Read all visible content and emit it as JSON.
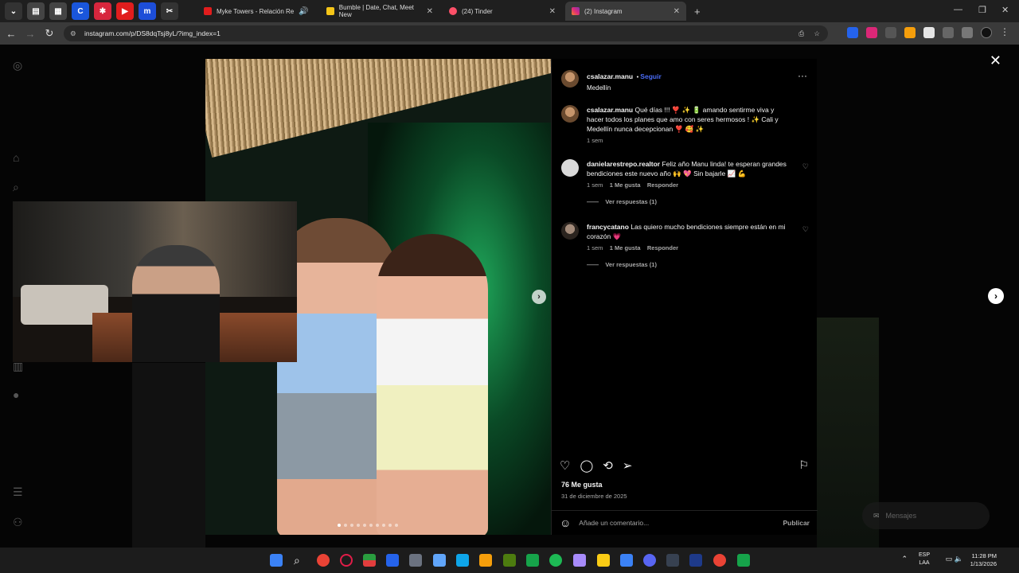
{
  "browser": {
    "tabs": [
      {
        "title": "Myke Towers - Relación Re",
        "audio": true
      },
      {
        "title": "Bumble | Date, Chat, Meet New"
      },
      {
        "title": "(24) Tinder"
      },
      {
        "title": "(2) Instagram",
        "active": true
      }
    ],
    "new_tab": "+",
    "url": "instagram.com/p/DS8dqTsj8yL/?img_index=1"
  },
  "post": {
    "author": "csalazar.manu",
    "follow_label": "Seguir",
    "location": "Medellín",
    "caption": "Qué días !!! ❣️ ✨ 🔋 amando sentirme viva y hacer todos los planes que amo con seres hermosos ! ✨ Cali y Medellín nunca decepcionan ❣️ 🥰 ✨",
    "caption_time": "1 sem",
    "comments": [
      {
        "user": "danielarestrepo.realtor",
        "text": "Feliz año Manu linda! te esperan grandes bendiciones este nuevo año 🙌 💖 Sin bajarle 📈 💪",
        "time": "1 sem",
        "likes": "1 Me gusta",
        "reply": "Responder",
        "view_replies": "Ver respuestas (1)"
      },
      {
        "user": "francycatano",
        "text": "Las quiero mucho bendiciones siempre están en mi corazón 💗",
        "time": "1 sem",
        "likes": "1 Me gusta",
        "reply": "Responder",
        "view_replies": "Ver respuestas (1)"
      }
    ],
    "likes": "76 Me gusta",
    "date": "31 de diciembre de 2025",
    "comment_placeholder": "Añade un comentario...",
    "publish_label": "Publicar",
    "carousel_count": 10,
    "carousel_index": 1
  },
  "messages_label": "Mensajes",
  "taskbar": {
    "lang_top": "ESP",
    "lang_bottom": "LAA",
    "time": "11:28 PM",
    "date": "1/13/2026"
  },
  "colors": {
    "instagram_blue": "#4a6cf7",
    "panel_bg": "#000000",
    "tab_bar": "#1f1f1f"
  }
}
